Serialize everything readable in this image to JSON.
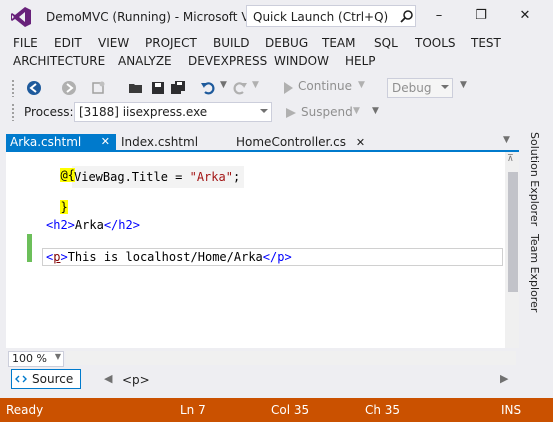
{
  "window": {
    "title": "DemoMVC (Running) - Microsoft Vi...",
    "quick_launch_placeholder": "Quick Launch (Ctrl+Q)",
    "minimize": "–",
    "restore": "❐",
    "close": "✕"
  },
  "menu": {
    "row1": [
      "FILE",
      "EDIT",
      "VIEW",
      "PROJECT",
      "BUILD",
      "DEBUG",
      "TEAM",
      "SQL",
      "TOOLS",
      "TEST"
    ],
    "row2": [
      "ARCHITECTURE",
      "ANALYZE",
      "DEVEXPRESS",
      "WINDOW",
      "HELP"
    ]
  },
  "toolbar": {
    "continue_label": "Continue",
    "config_value": "Debug",
    "process_label": "Process:",
    "process_value": "[3188] iisexpress.exe",
    "suspend_label": "Suspend"
  },
  "tabs": [
    {
      "label": "Arka.cshtml",
      "close": "✕",
      "active": true
    },
    {
      "label": "Index.cshtml",
      "active": false
    },
    {
      "label": "HomeController.cs",
      "close": "✕",
      "active": false
    }
  ],
  "side_panels": [
    "Solution Explorer",
    "Team Explorer"
  ],
  "editor": {
    "lines": [
      {
        "razor_open": "@{"
      },
      {
        "code_prefix": "ViewBag.Title = ",
        "string_literal": "\"Arka\"",
        "code_suffix": ";"
      },
      {
        "razor_close": "}"
      },
      {
        "tag_open": "<h2>",
        "text": "Arka",
        "tag_close": "</h2>"
      },
      {
        "tag_open_bracket": "<",
        "tag_name": "p",
        "tag_open_end": ">",
        "text": "This is localhost/Home/Arka",
        "tag_close": "</p>"
      }
    ]
  },
  "zoom_level": "100 %",
  "bottom": {
    "source_label": "Source",
    "tag_path": "<p>"
  },
  "status": {
    "state": "Ready",
    "line": "Ln 7",
    "col": "Col 35",
    "ch": "Ch 35",
    "mode": "INS"
  },
  "colors": {
    "accent": "#007acc",
    "statusbar_debug": "#ca5100",
    "vs_logo": "#68217a"
  }
}
